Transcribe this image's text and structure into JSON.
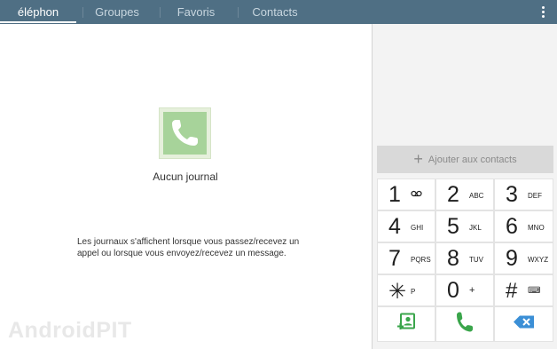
{
  "tabs": [
    {
      "label": "éléphon",
      "active": true
    },
    {
      "label": "Groupes",
      "active": false
    },
    {
      "label": "Favoris",
      "active": false
    },
    {
      "label": "Contacts",
      "active": false
    }
  ],
  "menu_icon": "overflow-menu-icon",
  "empty_state": {
    "icon": "phone-handset-icon",
    "title": "Aucun journal",
    "message": "Les journaux s'affichent lorsque vous passez/recevez un appel ou lorsque vous envoyez/recevez un message."
  },
  "watermark": "AndroidPIT",
  "dialer": {
    "add_contact_label": "Ajouter aux contacts",
    "keys": [
      {
        "digit": "1",
        "letters": "voicemail-icon"
      },
      {
        "digit": "2",
        "letters": "ABC"
      },
      {
        "digit": "3",
        "letters": "DEF"
      },
      {
        "digit": "4",
        "letters": "GHI"
      },
      {
        "digit": "5",
        "letters": "JKL"
      },
      {
        "digit": "6",
        "letters": "MNO"
      },
      {
        "digit": "7",
        "letters": "PQRS"
      },
      {
        "digit": "8",
        "letters": "TUV"
      },
      {
        "digit": "9",
        "letters": "WXYZ"
      },
      {
        "digit": "✳",
        "letters": "P"
      },
      {
        "digit": "0",
        "letters": "+"
      },
      {
        "digit": "#",
        "letters": "⌨"
      }
    ],
    "actions": [
      "contacts-add-icon",
      "call-icon",
      "backspace-icon"
    ]
  },
  "colors": {
    "tabbar": "#4f6f84",
    "accent_green": "#3aa54b",
    "backspace_blue": "#3b8fd6"
  }
}
